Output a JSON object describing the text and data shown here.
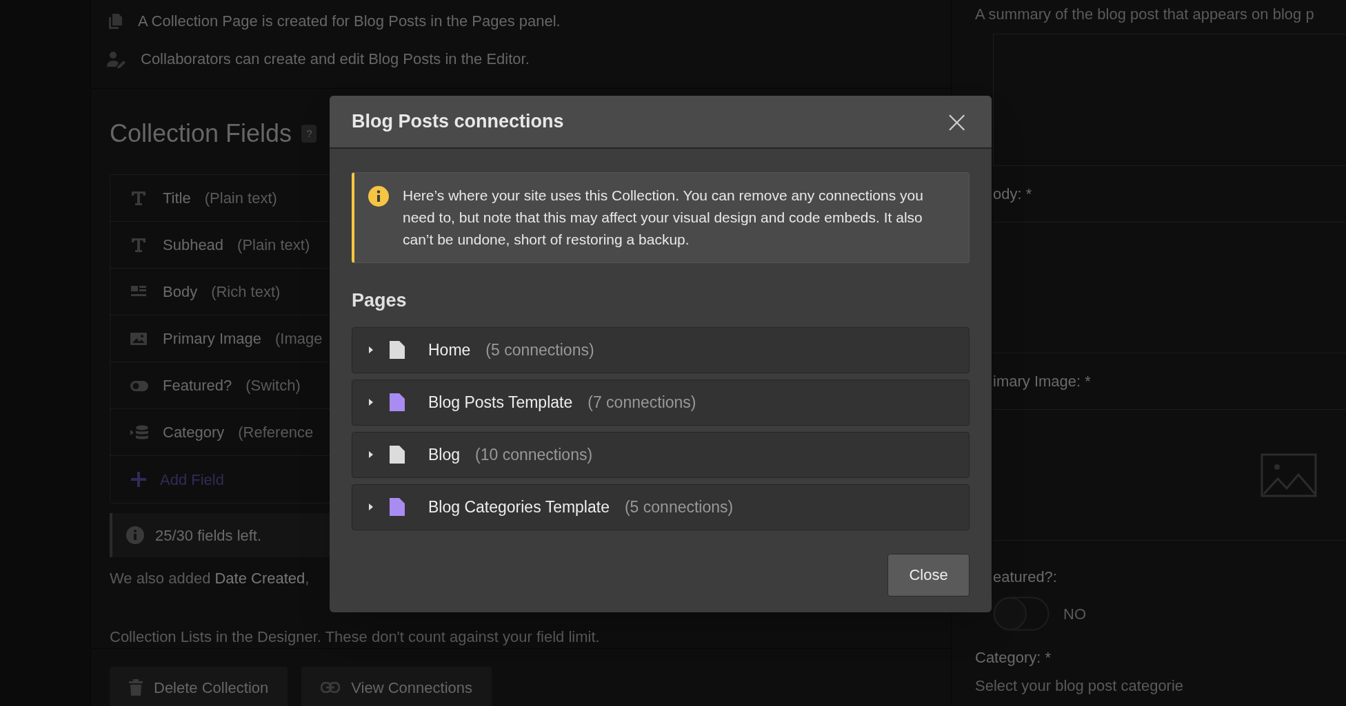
{
  "notes": [
    {
      "kind": "pages",
      "text": "A Collection Page is created for Blog Posts in the Pages panel."
    },
    {
      "kind": "collaborators",
      "text": "Collaborators can create and edit Blog Posts in the Editor."
    }
  ],
  "fields_panel": {
    "title": "Collection Fields",
    "help": "?",
    "fields": [
      {
        "kind": "text",
        "name": "Title",
        "type": "(Plain text)"
      },
      {
        "kind": "text",
        "name": "Subhead",
        "type": "(Plain text)"
      },
      {
        "kind": "richtext",
        "name": "Body",
        "type": "(Rich text)"
      },
      {
        "kind": "image",
        "name": "Primary Image",
        "type": "(Image"
      },
      {
        "kind": "switch",
        "name": "Featured?",
        "type": "(Switch)"
      },
      {
        "kind": "reference",
        "name": "Category",
        "type": "(Reference"
      }
    ],
    "add_field": "Add Field",
    "limit_note": "25/30 fields left.",
    "footnote_1": "We also added **Date Created**,",
    "footnote_2": "Collection Lists in the Designer. These don't count against your field limit.",
    "buttons": [
      {
        "kind": "delete",
        "label": "Delete Collection"
      },
      {
        "kind": "link",
        "label": "View Connections"
      }
    ]
  },
  "form": {
    "summary_hint": "A summary of the blog post that appears on blog p",
    "body_label": "ody: *",
    "image_label": "imary Image: *",
    "featured_label": "eatured?:",
    "featured_state": "NO",
    "category_label": "Category: *",
    "category_placeholder": "Select your blog post categorie"
  },
  "dialog": {
    "title": "Blog Posts connections",
    "close_icon": "×",
    "notice": "Here’s where your site uses this Collection. You can remove any connections you need to, but note that this may affect your visual design and code embeds. It also can’t be undone, short of restoring a backup.",
    "section": "Pages",
    "pages": [
      {
        "kind": "page",
        "name": "Home",
        "count": "(5 connections)"
      },
      {
        "kind": "template",
        "name": "Blog Posts Template",
        "count": "(7 connections)"
      },
      {
        "kind": "page",
        "name": "Blog",
        "count": "(10 connections)"
      },
      {
        "kind": "template",
        "name": "Blog Categories Template",
        "count": "(5 connections)"
      }
    ],
    "close_button": "Close"
  }
}
